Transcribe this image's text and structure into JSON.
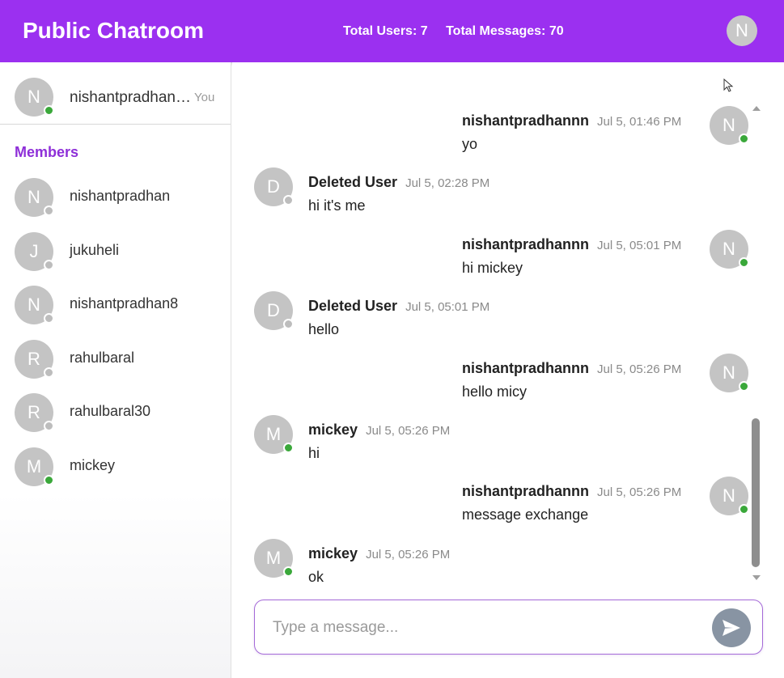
{
  "header": {
    "title": "Public Chatroom",
    "total_users": "Total Users: 7",
    "total_messages": "Total Messages: 70",
    "avatar_initial": "N"
  },
  "current_user": {
    "initial": "N",
    "name": "nishantpradhannn",
    "you_label": "You",
    "status": "online"
  },
  "members_title": "Members",
  "members": [
    {
      "initial": "N",
      "name": "nishantpradhan",
      "status": "offline"
    },
    {
      "initial": "J",
      "name": "jukuheli",
      "status": "offline"
    },
    {
      "initial": "N",
      "name": "nishantpradhan8",
      "status": "offline"
    },
    {
      "initial": "R",
      "name": "rahulbaral",
      "status": "offline"
    },
    {
      "initial": "R",
      "name": "rahulbaral30",
      "status": "offline"
    },
    {
      "initial": "M",
      "name": "mickey",
      "status": "online"
    }
  ],
  "messages": [
    {
      "side": "right",
      "initial": "N",
      "author": "nishantpradhannn",
      "time": "Jul 5, 01:46 PM",
      "text": "yo",
      "status": "online"
    },
    {
      "side": "left",
      "initial": "D",
      "author": "Deleted User",
      "time": "Jul 5, 02:28 PM",
      "text": "hi it's me",
      "status": "offline"
    },
    {
      "side": "right",
      "initial": "N",
      "author": "nishantpradhannn",
      "time": "Jul 5, 05:01 PM",
      "text": "hi mickey",
      "status": "online"
    },
    {
      "side": "left",
      "initial": "D",
      "author": "Deleted User",
      "time": "Jul 5, 05:01 PM",
      "text": "hello",
      "status": "offline"
    },
    {
      "side": "right",
      "initial": "N",
      "author": "nishantpradhannn",
      "time": "Jul 5, 05:26 PM",
      "text": "hello micy",
      "status": "online"
    },
    {
      "side": "left",
      "initial": "M",
      "author": "mickey",
      "time": "Jul 5, 05:26 PM",
      "text": "hi",
      "status": "online"
    },
    {
      "side": "right",
      "initial": "N",
      "author": "nishantpradhannn",
      "time": "Jul 5, 05:26 PM",
      "text": "message exchange",
      "status": "online"
    },
    {
      "side": "left",
      "initial": "M",
      "author": "mickey",
      "time": "Jul 5, 05:26 PM",
      "text": "ok",
      "status": "online"
    }
  ],
  "composer": {
    "placeholder": "Type a message...",
    "value": ""
  },
  "icons": {
    "send": "send-icon",
    "cursor": "mouse-pointer-icon"
  },
  "colors": {
    "brand": "#9b30f0",
    "online": "#3aa83a",
    "offline": "#bdbdbd"
  }
}
